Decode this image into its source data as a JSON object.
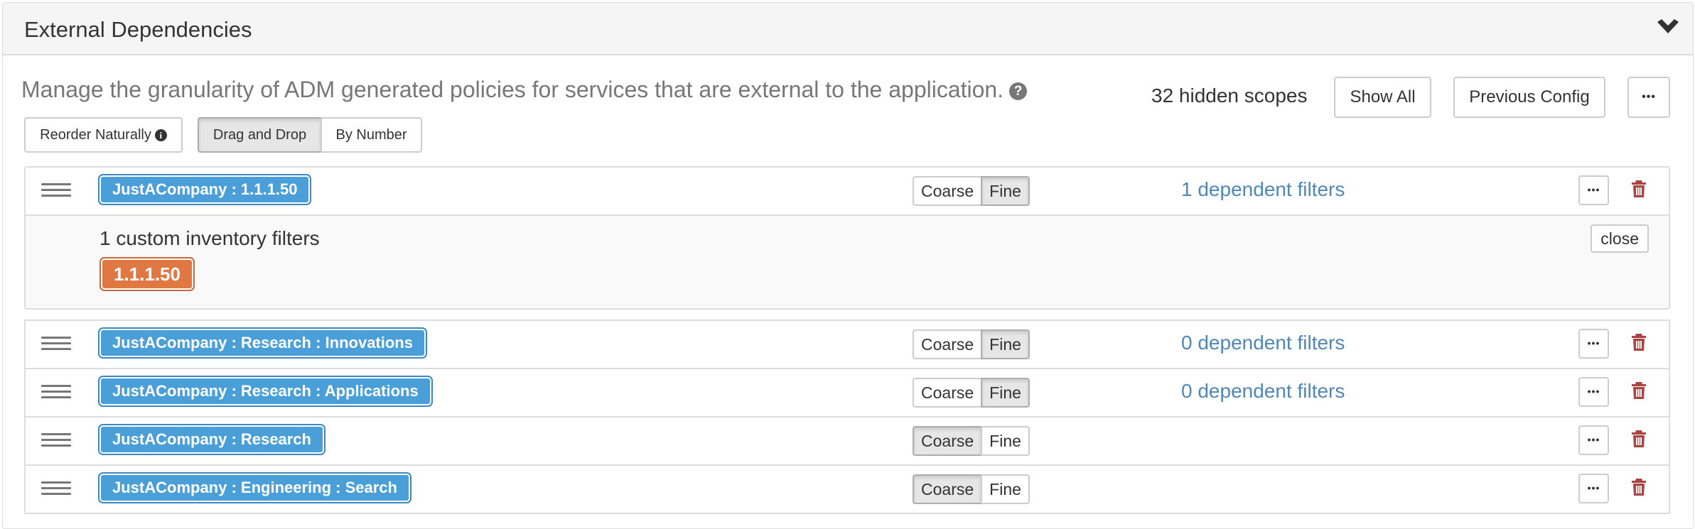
{
  "panel": {
    "title": "External Dependencies",
    "collapse_icon": "chevron-down-icon"
  },
  "description": {
    "text": "Manage the granularity of ADM generated policies for services that are external to the application.",
    "help_icon": "question-circle-icon"
  },
  "toolbar": {
    "hidden_scopes": "32 hidden scopes",
    "show_all_label": "Show All",
    "previous_config_label": "Previous Config",
    "more_label": "•••"
  },
  "ordering": {
    "reorder_naturally_label": "Reorder Naturally",
    "reorder_info_icon": "info-circle-icon",
    "modes": [
      {
        "label": "Drag and Drop",
        "active": true
      },
      {
        "label": "By Number",
        "active": false
      }
    ]
  },
  "granularity_options": [
    "Coarse",
    "Fine"
  ],
  "rows": [
    {
      "scope": "JustACompany : 1.1.1.50",
      "granularity": "Fine",
      "dependent_filters": "1 dependent filters",
      "expanded": true,
      "expanded_panel": {
        "title": "1 custom inventory filters",
        "filters": [
          "1.1.1.50"
        ],
        "close_label": "close"
      }
    },
    {
      "scope": "JustACompany : Research : Innovations",
      "granularity": "Fine",
      "dependent_filters": "0 dependent filters"
    },
    {
      "scope": "JustACompany : Research : Applications",
      "granularity": "Fine",
      "dependent_filters": "0 dependent filters"
    },
    {
      "scope": "JustACompany : Research",
      "granularity": "Coarse",
      "dependent_filters": ""
    },
    {
      "scope": "JustACompany : Engineering : Search",
      "granularity": "Coarse",
      "dependent_filters": ""
    }
  ],
  "row_more_label": "•••",
  "colors": {
    "scope_label": "#4a9fd8",
    "filter_chip": "#e07844",
    "link": "#4f87b8",
    "danger": "#a94442"
  }
}
